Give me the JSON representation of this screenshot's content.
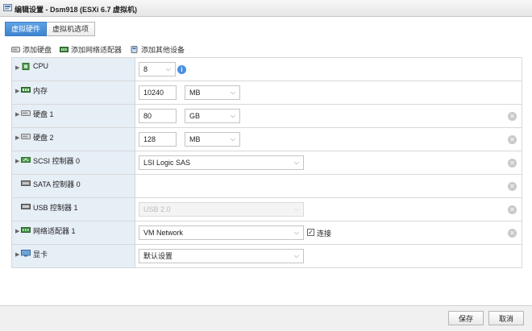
{
  "window": {
    "title": "编辑设置 - Dsm918 (ESXi 6.7 虚拟机)"
  },
  "tabs": [
    {
      "label": "虚拟硬件",
      "active": true
    },
    {
      "label": "虚拟机选项",
      "active": false
    }
  ],
  "toolbar": {
    "add_disk": "添加硬盘",
    "add_nic": "添加网络适配器",
    "add_other": "添加其他设备"
  },
  "rows": {
    "cpu": {
      "label": "CPU",
      "value": "8"
    },
    "memory": {
      "label": "内存",
      "value": "10240",
      "unit": "MB"
    },
    "disk1": {
      "label": "硬盘 1",
      "value": "80",
      "unit": "GB"
    },
    "disk2": {
      "label": "硬盘 2",
      "value": "128",
      "unit": "MB"
    },
    "scsi": {
      "label": "SCSI 控制器 0",
      "value": "LSI Logic SAS"
    },
    "sata": {
      "label": "SATA 控制器 0"
    },
    "usb": {
      "label": "USB 控制器 1",
      "value": "USB 2.0"
    },
    "nic": {
      "label": "网络适配器 1",
      "value": "VM Network",
      "connect_label": "连接",
      "connected": true
    },
    "display": {
      "label": "显卡",
      "value": "默认设置"
    }
  },
  "footer": {
    "save": "保存",
    "cancel": "取消"
  },
  "colors": {
    "accent": "#3d84cf",
    "label_bg": "#e6eef6",
    "remove_icon": "#c9c9c9",
    "info_icon": "#4a90e2"
  }
}
